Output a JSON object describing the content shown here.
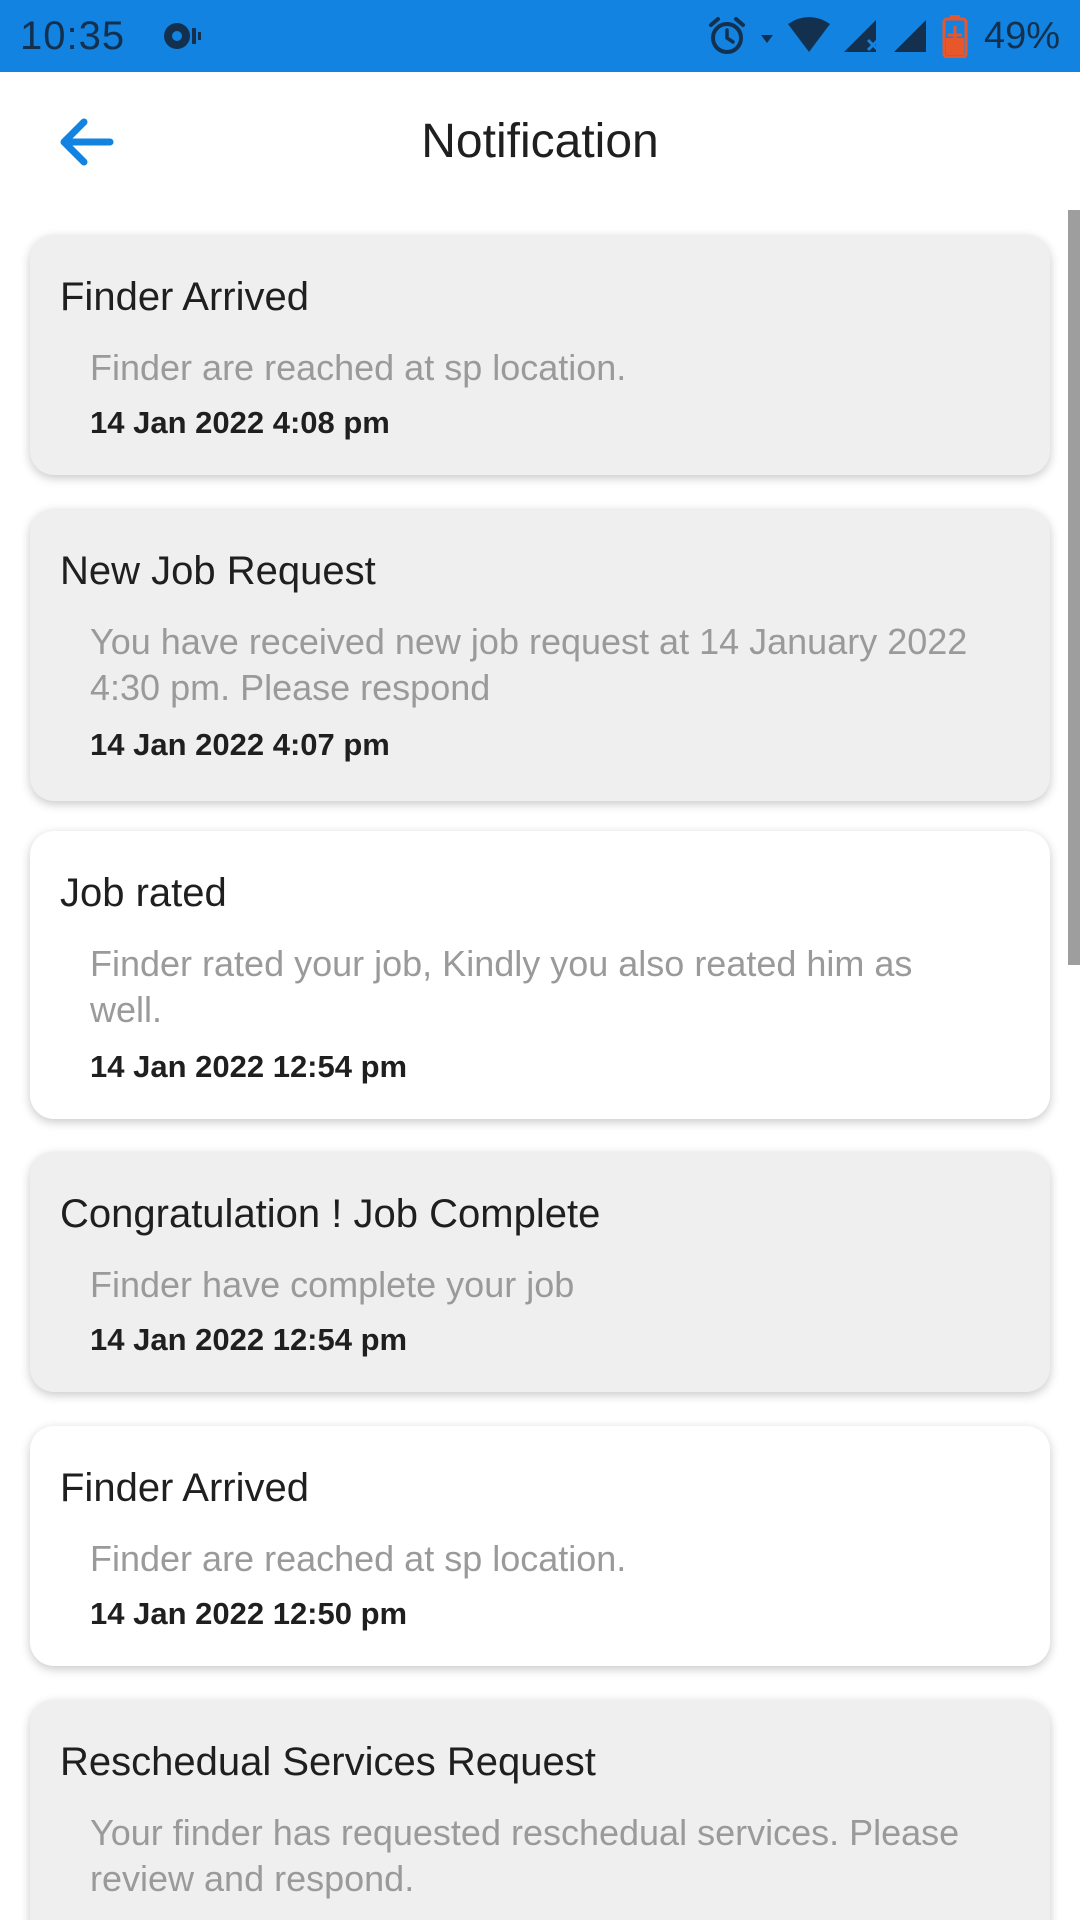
{
  "status_bar": {
    "time": "10:35",
    "battery": "49%",
    "icons": [
      "sync-icon",
      "alarm-icon",
      "wifi-icon",
      "signal-icon",
      "signal-icon",
      "battery-charging-icon"
    ]
  },
  "app_bar": {
    "title": "Notification",
    "back_icon": "arrow-left-icon",
    "accent_color": "#1283e0"
  },
  "notifications": [
    {
      "title": "Finder Arrived",
      "message": "Finder are reached at sp location.",
      "time": "14 Jan 2022 4:08 pm",
      "state": "unread"
    },
    {
      "title": "New Job Request",
      "message": "You have received new job request at 14 January 2022 4:30 pm. Please respond",
      "time": "14 Jan 2022 4:07 pm",
      "state": "unread"
    },
    {
      "title": "Job rated",
      "message": "Finder rated your job, Kindly you also reated him as well.",
      "time": "14 Jan 2022 12:54 pm",
      "state": "read"
    },
    {
      "title": "Congratulation ! Job Complete",
      "message": "Finder have complete your job",
      "time": "14 Jan 2022 12:54 pm",
      "state": "unread"
    },
    {
      "title": "Finder Arrived",
      "message": "Finder are reached at sp location.",
      "time": "14 Jan 2022 12:50 pm",
      "state": "read"
    },
    {
      "title": "Reschedual Services Request",
      "message": "Your finder has requested reschedual services. Please review and respond.",
      "time": "",
      "state": "unread"
    }
  ]
}
